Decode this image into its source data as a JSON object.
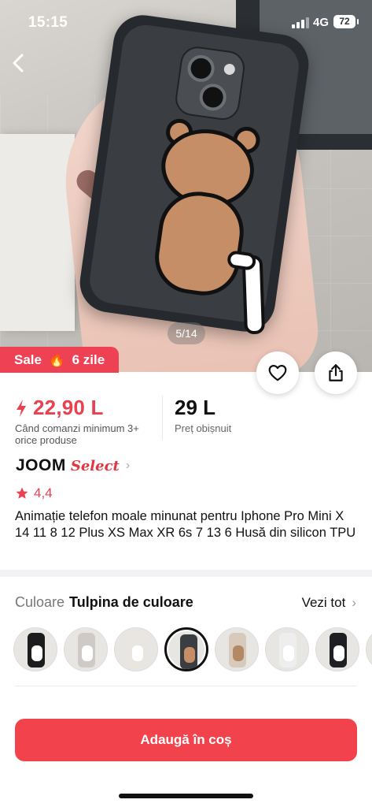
{
  "status_bar": {
    "time": "15:15",
    "network": "4G",
    "battery": "72"
  },
  "gallery": {
    "page_indicator": "5/14"
  },
  "sale_badge": {
    "label": "Sale",
    "icon": "fire-icon",
    "duration": "6 zile"
  },
  "price": {
    "sale_price": "22,90 L",
    "sale_condition": "Când comanzi minimum 3+ orice produse",
    "regular_price": "29 L",
    "regular_label": "Preț obișnuit",
    "accent_color": "#e8414f"
  },
  "brand": {
    "name": "JOOM",
    "tag": "Select"
  },
  "rating": {
    "value": "4,4"
  },
  "product": {
    "title": "Animație telefon moale minunat pentru Iphone Pro Mini X 14 11 8 12 Plus XS Max XR 6s 7 13 6 Husă din silicon TPU"
  },
  "color_selector": {
    "label": "Culoare",
    "selected": "Tulpina de culoare",
    "see_all": "Vezi tot",
    "swatches": [
      {
        "case": "#1b1c1e",
        "fig": "#ffffff"
      },
      {
        "case": "#cfcac6",
        "fig": "#ffffff"
      },
      {
        "case": "#e9e6df",
        "fig": "#ffffff"
      },
      {
        "case": "#3a3d41",
        "fig": "#c58e67"
      },
      {
        "case": "#d8c9bd",
        "fig": "#b38865"
      },
      {
        "case": "#eeeeee",
        "fig": "#ffffff"
      },
      {
        "case": "#1e1f22",
        "fig": "#ffffff"
      },
      {
        "case": "#d8cfc8",
        "fig": "#ffffff"
      }
    ]
  },
  "cart_button": {
    "label": "Adaugă în coș",
    "color": "#f2434d"
  }
}
